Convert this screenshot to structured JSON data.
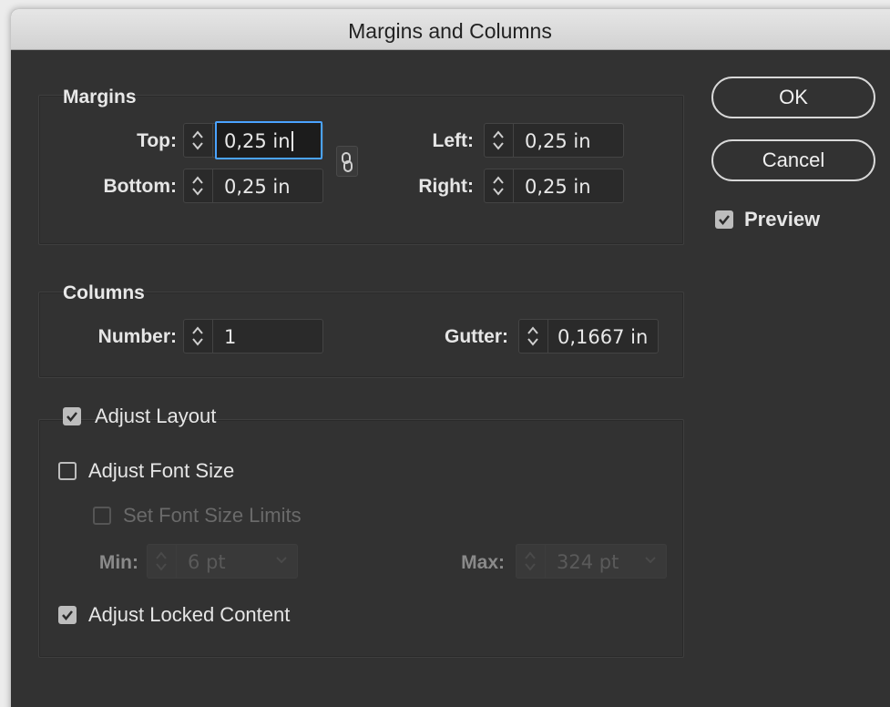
{
  "window": {
    "title": "Margins and Columns"
  },
  "margins": {
    "label": "Margins",
    "top": {
      "label": "Top:",
      "value": "0,25 in"
    },
    "bottom": {
      "label": "Bottom:",
      "value": "0,25 in"
    },
    "left": {
      "label": "Left:",
      "value": "0,25 in"
    },
    "right": {
      "label": "Right:",
      "value": "0,25 in"
    }
  },
  "columns": {
    "label": "Columns",
    "number": {
      "label": "Number:",
      "value": "1"
    },
    "gutter": {
      "label": "Gutter:",
      "value": "0,1667 in"
    }
  },
  "adjust_layout": {
    "label": "Adjust Layout",
    "checked": true,
    "adjust_font_size": {
      "label": "Adjust Font Size",
      "checked": false
    },
    "set_font_size_limits": {
      "label": "Set Font Size Limits",
      "checked": false,
      "enabled": false
    },
    "min": {
      "label": "Min:",
      "value": "6 pt"
    },
    "max": {
      "label": "Max:",
      "value": "324 pt"
    },
    "adjust_locked_content": {
      "label": "Adjust Locked Content",
      "checked": true
    }
  },
  "buttons": {
    "ok": "OK",
    "cancel": "Cancel"
  },
  "preview": {
    "label": "Preview",
    "checked": true
  },
  "icons": {
    "spinner": "stepper-arrows-icon",
    "link": "chain-link-icon",
    "dropdown": "chevron-down-icon",
    "check": "checkmark-icon"
  }
}
